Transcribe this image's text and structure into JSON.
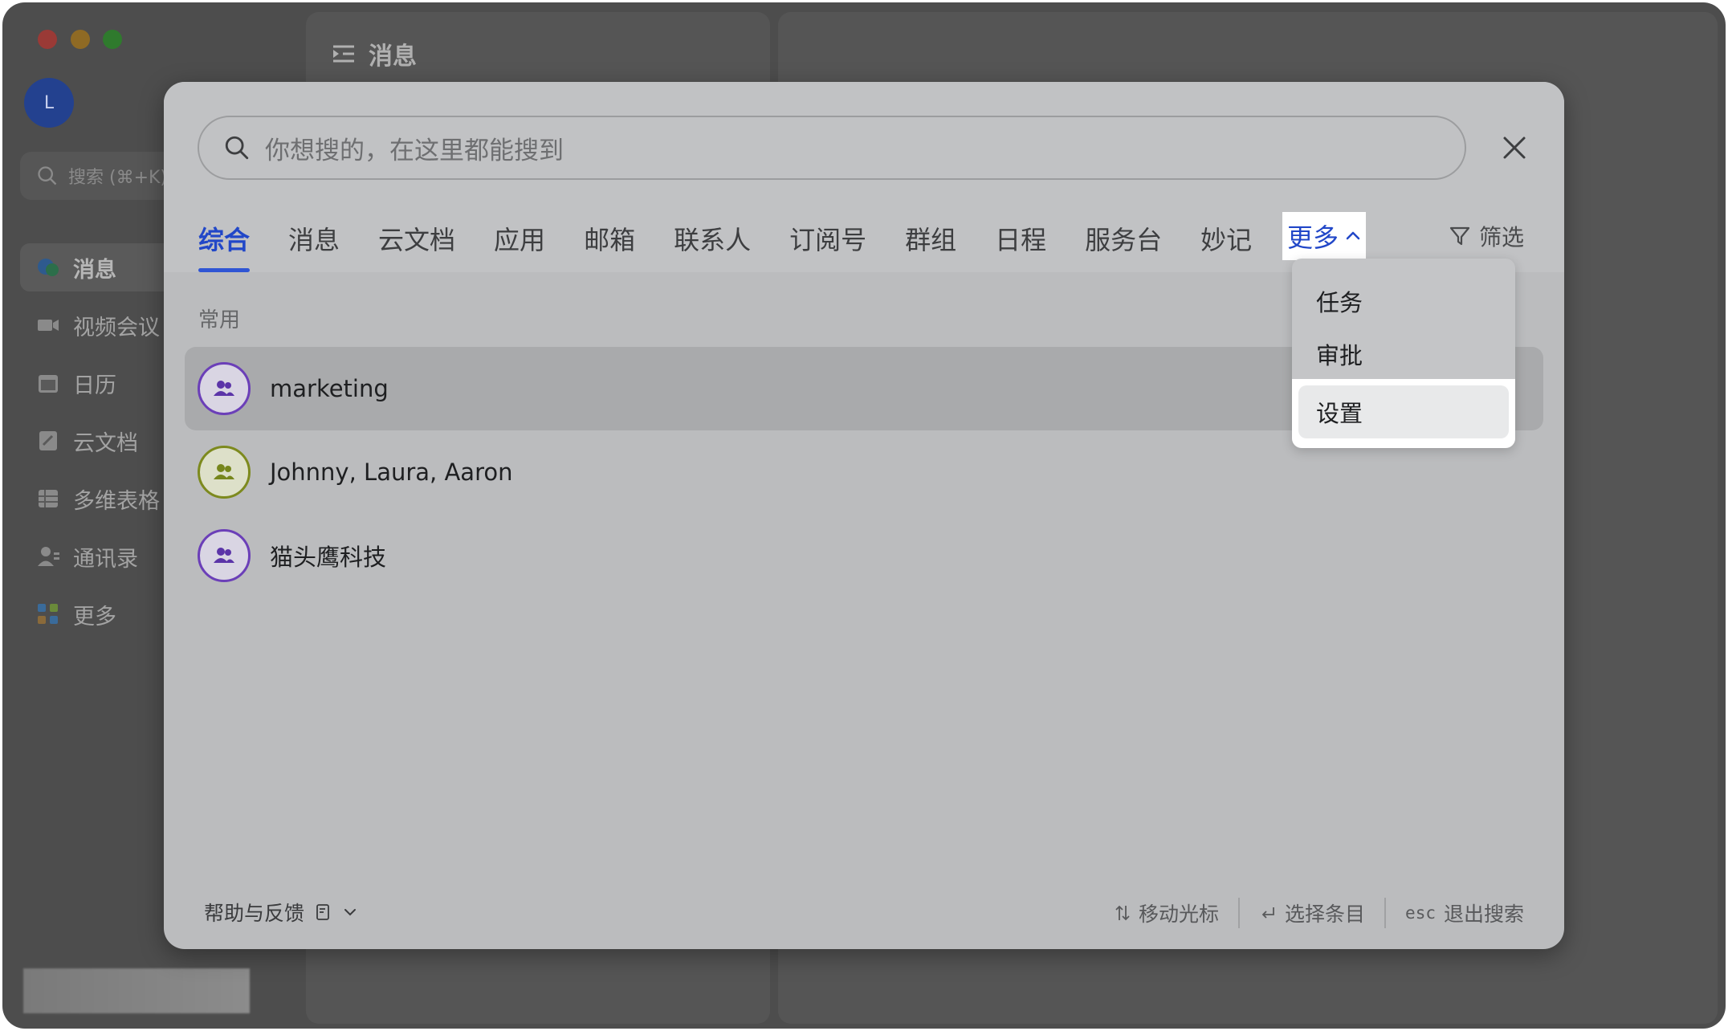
{
  "app": {
    "sidebar": {
      "avatar_letter": "L",
      "search_label": "搜索 (⌘+K)",
      "items": [
        {
          "label": "消息",
          "icon": "chat-bubble-icon",
          "active": true
        },
        {
          "label": "视频会议",
          "icon": "video-camera-icon"
        },
        {
          "label": "日历",
          "icon": "calendar-icon"
        },
        {
          "label": "云文档",
          "icon": "document-icon"
        },
        {
          "label": "多维表格",
          "icon": "table-icon"
        },
        {
          "label": "通讯录",
          "icon": "contacts-icon"
        },
        {
          "label": "更多",
          "icon": "apps-grid-icon"
        }
      ]
    },
    "messages_panel": {
      "title": "消息",
      "icon": "collapse-list-icon"
    }
  },
  "search": {
    "placeholder": "你想搜的，在这里都能搜到",
    "tabs": [
      "综合",
      "消息",
      "云文档",
      "应用",
      "邮箱",
      "联系人",
      "订阅号",
      "群组",
      "日程",
      "服务台",
      "妙记"
    ],
    "active_tab": "综合",
    "more_tab_label": "更多",
    "filter_label": "筛选",
    "section_label": "常用",
    "results": [
      {
        "name": "marketing",
        "ring_color": "#6b3fb8",
        "icon_color": "#5b34a8"
      },
      {
        "name": "Johnny, Laura, Aaron",
        "ring_color": "#7d8a1e",
        "icon_color": "#76861c"
      },
      {
        "name": "猫头鹰科技",
        "ring_color": "#6b3fb8",
        "icon_color": "#5b34a8"
      }
    ],
    "more_menu": {
      "items": [
        "任务",
        "审批",
        "设置"
      ],
      "selected": "设置"
    },
    "footer": {
      "help_label": "帮助与反馈",
      "hint_move": "移动光标",
      "hint_select": "选择条目",
      "hint_esc_key": "esc",
      "hint_exit": "退出搜索"
    }
  },
  "colors": {
    "accent": "#2147c8",
    "modal_bg": "#bbbcbe",
    "window_bg": "#4d4d4d"
  }
}
